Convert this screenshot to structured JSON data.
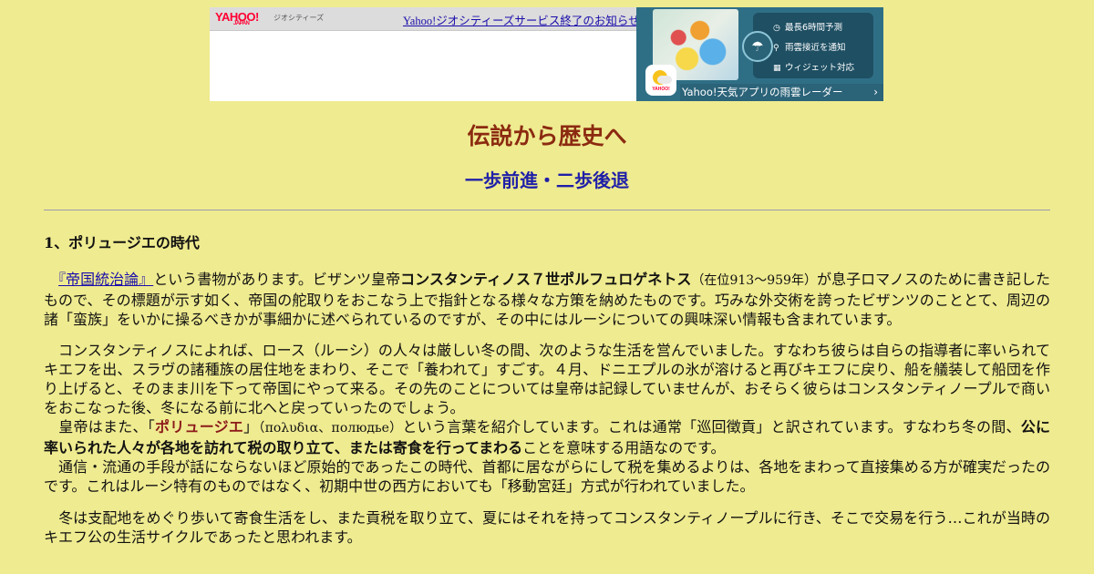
{
  "ad": {
    "yahoo_logo": "YAHOO!",
    "yahoo_logo_sub": "JAPAN",
    "geocities": "ジオシティーズ",
    "notice_link": "Yahoo!ジオシティーズサービス終了のお知らせ",
    "features": [
      "最長6時間予測",
      "雨雲接近を通知",
      "ウィジェット対応"
    ],
    "app_brand": "YAHOO!",
    "cta": "Yahoo!天気アプリの雨雲レーダー",
    "cta_arrow": "›"
  },
  "header": {
    "title": "伝説から歴史へ",
    "subtitle": "一歩前進・二歩後退"
  },
  "section": {
    "title": "1、ポリュージエの時代"
  },
  "p1": {
    "indent": "　",
    "book_link": "『帝国統治論』",
    "t1": "という書物があります。ビザンツ皇帝",
    "emperor": "コンスタンティノス７世ポルフュロゲネトス",
    "reign": "（在位913～959年）",
    "t2": "が息子ロマノスのために書き記したもので、その標題が示す如く、帝国の舵取りをおこなう上で指針となる様々な方策を納めたものです。巧みな外交術を誇ったビザンツのこととて、周辺の諸「蛮族」をいかに操るべきかが事細かに述べられているのですが、その中にはルーシについての興味深い情報も含まれています。"
  },
  "p2": {
    "s1": "　コンスタンティノスによれば、ロース（ルーシ）の人々は厳しい冬の間、次のような生活を営んでいました。すなわち彼らは自らの指導者に率いられてキエフを出、スラヴの諸種族の居住地をまわり、そこで「養われて」すごす。４月、ドニエプルの氷が溶けると再びキエフに戻り、船を艤装して船団を作り上げると、そのまま川を下って帝国にやって来る。その先のことについては皇帝は記録していませんが、おそらく彼らはコンスタンティノープルで商いをおこなった後、冬になる前に北へと戻っていったのでしょう。",
    "s2a": "　皇帝はまた、「",
    "polyudie": "ポリュージエ",
    "s2b": "」",
    "greek": "（πολυδια、полюдье）",
    "s2c": "という言葉を紹介しています。これは通常「巡回徴貢」と訳されています。すなわち冬の間、",
    "bold_phrase": "公に率いられた人々が各地を訪れて税の取り立て、または寄食を行ってまわる",
    "s2d": "ことを意味する用語なのです。",
    "s3": "　通信・流通の手段が話にならないほど原始的であったこの時代、首都に居ながらにして税を集めるよりは、各地をまわって直接集める方が確実だったのです。これはルーシ特有のものではなく、初期中世の西方においても「移動宮廷」方式が行われていました。"
  },
  "p3": {
    "text": "　冬は支配地をめぐり歩いて寄食生活をし、また貢税を取り立て、夏にはそれを持ってコンスタンティノープルに行き、そこで交易を行う…これが当時のキエフ公の生活サイクルであったと思われます。"
  },
  "colors": {
    "background": "#efeb90",
    "title": "#8b2a10",
    "subtitle": "#1f1fa8",
    "link": "#1a0dab"
  }
}
